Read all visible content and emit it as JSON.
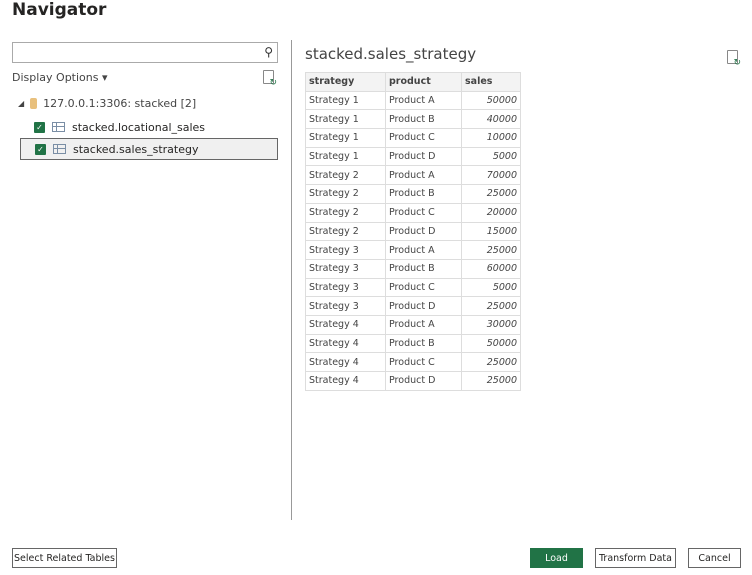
{
  "title": "Navigator",
  "search": {
    "value": "",
    "placeholder": ""
  },
  "display_options": "Display Options ▾",
  "tree": {
    "root": "127.0.0.1:3306: stacked [2]",
    "items": [
      {
        "label": "stacked.locational_sales",
        "checked": true
      },
      {
        "label": "stacked.sales_strategy",
        "checked": true,
        "selected": true
      }
    ]
  },
  "preview": {
    "title": "stacked.sales_strategy",
    "columns": [
      "strategy",
      "product",
      "sales"
    ],
    "rows": [
      [
        "Strategy 1",
        "Product A",
        "50000"
      ],
      [
        "Strategy 1",
        "Product B",
        "40000"
      ],
      [
        "Strategy 1",
        "Product C",
        "10000"
      ],
      [
        "Strategy 1",
        "Product D",
        "5000"
      ],
      [
        "Strategy 2",
        "Product A",
        "70000"
      ],
      [
        "Strategy 2",
        "Product B",
        "25000"
      ],
      [
        "Strategy 2",
        "Product C",
        "20000"
      ],
      [
        "Strategy 2",
        "Product D",
        "15000"
      ],
      [
        "Strategy 3",
        "Product A",
        "25000"
      ],
      [
        "Strategy 3",
        "Product B",
        "60000"
      ],
      [
        "Strategy 3",
        "Product C",
        "5000"
      ],
      [
        "Strategy 3",
        "Product D",
        "25000"
      ],
      [
        "Strategy 4",
        "Product A",
        "30000"
      ],
      [
        "Strategy 4",
        "Product B",
        "50000"
      ],
      [
        "Strategy 4",
        "Product C",
        "25000"
      ],
      [
        "Strategy 4",
        "Product D",
        "25000"
      ]
    ]
  },
  "buttons": {
    "select_related": "Select Related Tables",
    "load": "Load",
    "transform": "Transform Data",
    "cancel": "Cancel"
  },
  "colors": {
    "accent": "#217346"
  }
}
